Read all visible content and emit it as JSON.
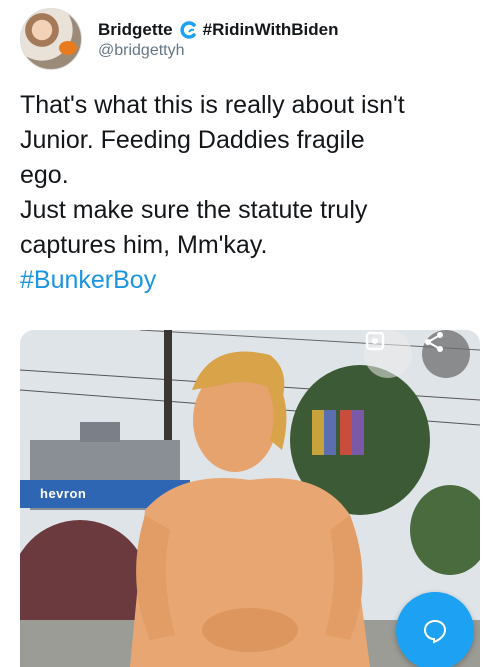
{
  "author": {
    "display_name": "Bridgette",
    "name_hashtag": "#RidinWithBiden",
    "handle": "@bridgettyh",
    "badge_icon": "wave-icon"
  },
  "tweet": {
    "lines": [
      "That's what this is really about isn't",
      "Junior. Feeding Daddies fragile",
      "ego.",
      "Just make sure the statute truly",
      "captures him, Mm'kay."
    ],
    "hashtag": "#BunkerBoy"
  },
  "media": {
    "sign_text": "hevron",
    "expand_icon": "expand-icon",
    "share_icon": "share-icon"
  },
  "fab": {
    "icon": "reply-bubble-icon"
  },
  "colors": {
    "link": "#1b95e0",
    "fab": "#1da1f2",
    "handle": "#657786"
  }
}
